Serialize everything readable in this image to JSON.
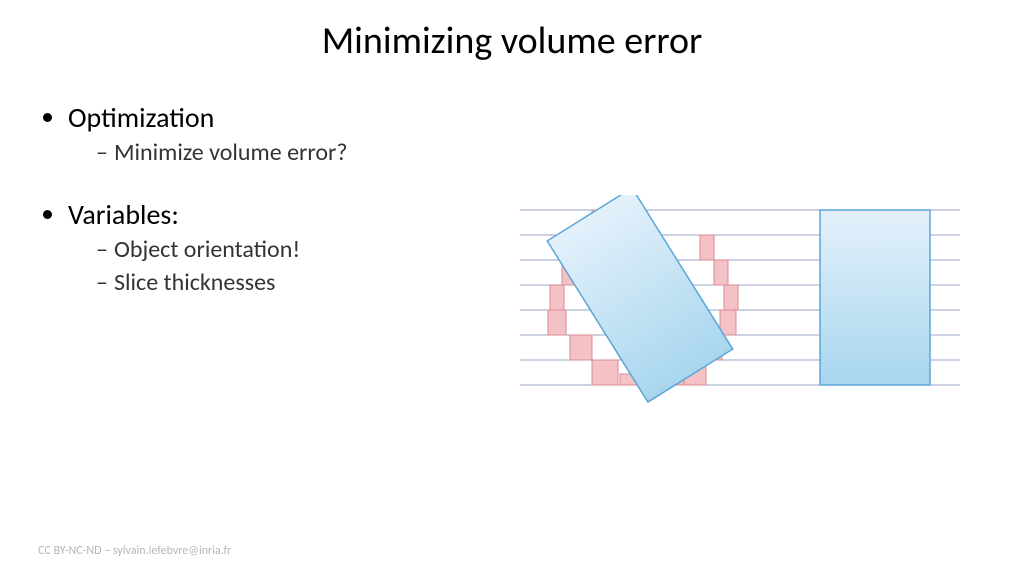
{
  "title": "Minimizing volume error",
  "bullets": [
    {
      "label": "Optimization",
      "sub": [
        "Minimize volume error?"
      ]
    },
    {
      "label": "Variables:",
      "sub": [
        "Object orientation!",
        "Slice thicknesses"
      ]
    }
  ],
  "footer": "CC BY-NC-ND – sylvain.lefebvre@inria.fr",
  "figure": {
    "description": "Two light-blue rectangles over horizontal slicing lines; left rectangle rotated ~30° showing pink staircase volume error at edges, right rectangle axis-aligned with no error.",
    "slice_count": 8,
    "colors": {
      "rect_fill_top": "#e4f1fb",
      "rect_fill_bottom": "#a8d6ee",
      "rect_stroke": "#5aa6d6",
      "error_fill": "#f4c1c6",
      "error_stroke": "#d98a93",
      "grid": "#9aa4c8"
    }
  }
}
